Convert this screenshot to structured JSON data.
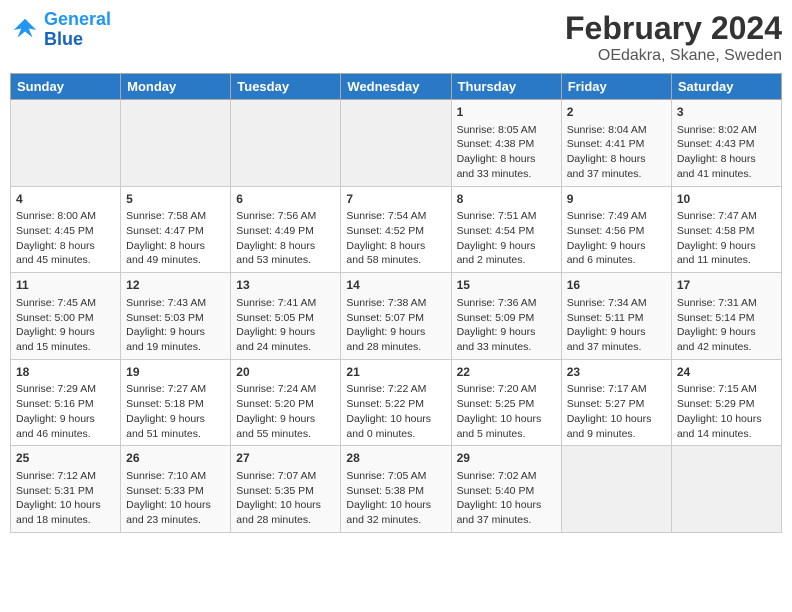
{
  "header": {
    "logo_line1": "General",
    "logo_line2": "Blue",
    "main_title": "February 2024",
    "subtitle": "OEdakra, Skane, Sweden"
  },
  "days_of_week": [
    "Sunday",
    "Monday",
    "Tuesday",
    "Wednesday",
    "Thursday",
    "Friday",
    "Saturday"
  ],
  "weeks": [
    [
      {
        "day": "",
        "info": ""
      },
      {
        "day": "",
        "info": ""
      },
      {
        "day": "",
        "info": ""
      },
      {
        "day": "",
        "info": ""
      },
      {
        "day": "1",
        "info": "Sunrise: 8:05 AM\nSunset: 4:38 PM\nDaylight: 8 hours\nand 33 minutes."
      },
      {
        "day": "2",
        "info": "Sunrise: 8:04 AM\nSunset: 4:41 PM\nDaylight: 8 hours\nand 37 minutes."
      },
      {
        "day": "3",
        "info": "Sunrise: 8:02 AM\nSunset: 4:43 PM\nDaylight: 8 hours\nand 41 minutes."
      }
    ],
    [
      {
        "day": "4",
        "info": "Sunrise: 8:00 AM\nSunset: 4:45 PM\nDaylight: 8 hours\nand 45 minutes."
      },
      {
        "day": "5",
        "info": "Sunrise: 7:58 AM\nSunset: 4:47 PM\nDaylight: 8 hours\nand 49 minutes."
      },
      {
        "day": "6",
        "info": "Sunrise: 7:56 AM\nSunset: 4:49 PM\nDaylight: 8 hours\nand 53 minutes."
      },
      {
        "day": "7",
        "info": "Sunrise: 7:54 AM\nSunset: 4:52 PM\nDaylight: 8 hours\nand 58 minutes."
      },
      {
        "day": "8",
        "info": "Sunrise: 7:51 AM\nSunset: 4:54 PM\nDaylight: 9 hours\nand 2 minutes."
      },
      {
        "day": "9",
        "info": "Sunrise: 7:49 AM\nSunset: 4:56 PM\nDaylight: 9 hours\nand 6 minutes."
      },
      {
        "day": "10",
        "info": "Sunrise: 7:47 AM\nSunset: 4:58 PM\nDaylight: 9 hours\nand 11 minutes."
      }
    ],
    [
      {
        "day": "11",
        "info": "Sunrise: 7:45 AM\nSunset: 5:00 PM\nDaylight: 9 hours\nand 15 minutes."
      },
      {
        "day": "12",
        "info": "Sunrise: 7:43 AM\nSunset: 5:03 PM\nDaylight: 9 hours\nand 19 minutes."
      },
      {
        "day": "13",
        "info": "Sunrise: 7:41 AM\nSunset: 5:05 PM\nDaylight: 9 hours\nand 24 minutes."
      },
      {
        "day": "14",
        "info": "Sunrise: 7:38 AM\nSunset: 5:07 PM\nDaylight: 9 hours\nand 28 minutes."
      },
      {
        "day": "15",
        "info": "Sunrise: 7:36 AM\nSunset: 5:09 PM\nDaylight: 9 hours\nand 33 minutes."
      },
      {
        "day": "16",
        "info": "Sunrise: 7:34 AM\nSunset: 5:11 PM\nDaylight: 9 hours\nand 37 minutes."
      },
      {
        "day": "17",
        "info": "Sunrise: 7:31 AM\nSunset: 5:14 PM\nDaylight: 9 hours\nand 42 minutes."
      }
    ],
    [
      {
        "day": "18",
        "info": "Sunrise: 7:29 AM\nSunset: 5:16 PM\nDaylight: 9 hours\nand 46 minutes."
      },
      {
        "day": "19",
        "info": "Sunrise: 7:27 AM\nSunset: 5:18 PM\nDaylight: 9 hours\nand 51 minutes."
      },
      {
        "day": "20",
        "info": "Sunrise: 7:24 AM\nSunset: 5:20 PM\nDaylight: 9 hours\nand 55 minutes."
      },
      {
        "day": "21",
        "info": "Sunrise: 7:22 AM\nSunset: 5:22 PM\nDaylight: 10 hours\nand 0 minutes."
      },
      {
        "day": "22",
        "info": "Sunrise: 7:20 AM\nSunset: 5:25 PM\nDaylight: 10 hours\nand 5 minutes."
      },
      {
        "day": "23",
        "info": "Sunrise: 7:17 AM\nSunset: 5:27 PM\nDaylight: 10 hours\nand 9 minutes."
      },
      {
        "day": "24",
        "info": "Sunrise: 7:15 AM\nSunset: 5:29 PM\nDaylight: 10 hours\nand 14 minutes."
      }
    ],
    [
      {
        "day": "25",
        "info": "Sunrise: 7:12 AM\nSunset: 5:31 PM\nDaylight: 10 hours\nand 18 minutes."
      },
      {
        "day": "26",
        "info": "Sunrise: 7:10 AM\nSunset: 5:33 PM\nDaylight: 10 hours\nand 23 minutes."
      },
      {
        "day": "27",
        "info": "Sunrise: 7:07 AM\nSunset: 5:35 PM\nDaylight: 10 hours\nand 28 minutes."
      },
      {
        "day": "28",
        "info": "Sunrise: 7:05 AM\nSunset: 5:38 PM\nDaylight: 10 hours\nand 32 minutes."
      },
      {
        "day": "29",
        "info": "Sunrise: 7:02 AM\nSunset: 5:40 PM\nDaylight: 10 hours\nand 37 minutes."
      },
      {
        "day": "",
        "info": ""
      },
      {
        "day": "",
        "info": ""
      }
    ]
  ]
}
